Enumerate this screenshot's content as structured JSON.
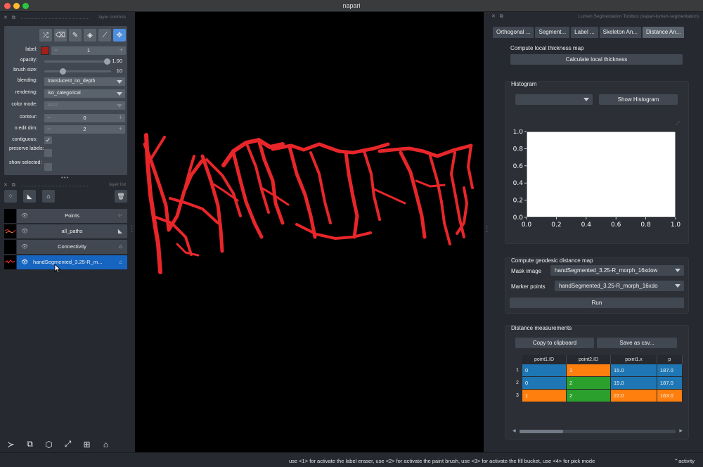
{
  "window": {
    "title": "napari"
  },
  "left_dock": {
    "controls_title": "layer controls",
    "list_title": "layer list",
    "controls": {
      "label": {
        "name": "label:",
        "value": "1"
      },
      "opacity": {
        "name": "opacity:",
        "value": "1.00",
        "fraction": 0.9
      },
      "brush_size": {
        "name": "brush size:",
        "value": "10",
        "fraction": 0.3
      },
      "blending": {
        "name": "blending:",
        "value": "translucent_no_depth"
      },
      "rendering": {
        "name": "rendering:",
        "value": "iso_categorical"
      },
      "color_mode": {
        "name": "color mode:",
        "value": "auto"
      },
      "contour": {
        "name": "contour:",
        "value": "0"
      },
      "n_edit_dim": {
        "name": "n edit dim:",
        "value": "2"
      },
      "contiguous": {
        "name": "contiguous:",
        "checked": true
      },
      "preserve_labels": {
        "name": "preserve labels:",
        "checked": false
      },
      "show_selected": {
        "name": "show selected:",
        "checked": false
      }
    },
    "label_color": "#a41f16",
    "layers": [
      {
        "name": "Points",
        "type_icon": "points-icon",
        "selected": false
      },
      {
        "name": "all_paths",
        "type_icon": "shapes-icon",
        "selected": false
      },
      {
        "name": "Connectivity",
        "type_icon": "labels-icon",
        "selected": false
      },
      {
        "name": "handSegmented_3.25-R_m...",
        "type_icon": "labels-icon",
        "selected": true
      }
    ]
  },
  "right_dock": {
    "title": "Lumen Segmentation Toolbox (napari-lumen-segmentation)",
    "tabs": [
      "Orthogonal ...",
      "Segment...",
      "Label ...",
      "Skeleton An...",
      "Distance An..."
    ],
    "active_tab": 4,
    "thickness": {
      "title": "Compute local thickness map",
      "button": "Calculate local thickness"
    },
    "histogram": {
      "title": "Histogram",
      "select_value": "",
      "button": "Show Histogram"
    },
    "geodesic": {
      "title": "Compute geodesic distance map",
      "mask_label": "Mask image",
      "mask_value": "handSegmented_3.25-R_morph_16xdow",
      "marker_label": "Marker points",
      "marker_value": "handSegmented_3.25-R_morph_16xdo",
      "run_button": "Run"
    },
    "distance": {
      "title": "Distance measurements",
      "copy_button": "Copy to clipboard",
      "save_button": "Save as csv...",
      "columns": [
        "point1.ID",
        "point2.ID",
        "point1.x",
        "p"
      ],
      "rows": [
        {
          "num": "1",
          "cells": [
            "0",
            "1",
            "15.0",
            "187.0"
          ]
        },
        {
          "num": "2",
          "cells": [
            "0",
            "2",
            "15.0",
            "187.0"
          ]
        },
        {
          "num": "3",
          "cells": [
            "1",
            "2",
            "22.0",
            "163.0"
          ]
        }
      ]
    }
  },
  "chart_data": {
    "type": "line",
    "title": "",
    "xlabel": "",
    "ylabel": "",
    "xlim": [
      0.0,
      1.0
    ],
    "ylim": [
      0.0,
      1.0
    ],
    "xticks": [
      "0.0",
      "0.2",
      "0.4",
      "0.6",
      "0.8",
      "1.0"
    ],
    "yticks": [
      "0.0",
      "0.2",
      "0.4",
      "0.6",
      "0.8",
      "1.0"
    ],
    "series": []
  },
  "status": {
    "message": "use <1> for activate the label eraser, use <2> for activate the paint brush, use <3> for activate the fill bucket, use <4> for pick mode",
    "activity": "activity"
  },
  "colors": {
    "background": "#262930",
    "panel": "#414851",
    "accent": "#1665c0",
    "segmentation": "#e8262a",
    "cell_blue": "#1e77b4",
    "cell_orange": "#ff7f0e",
    "cell_green": "#2ca02c"
  }
}
